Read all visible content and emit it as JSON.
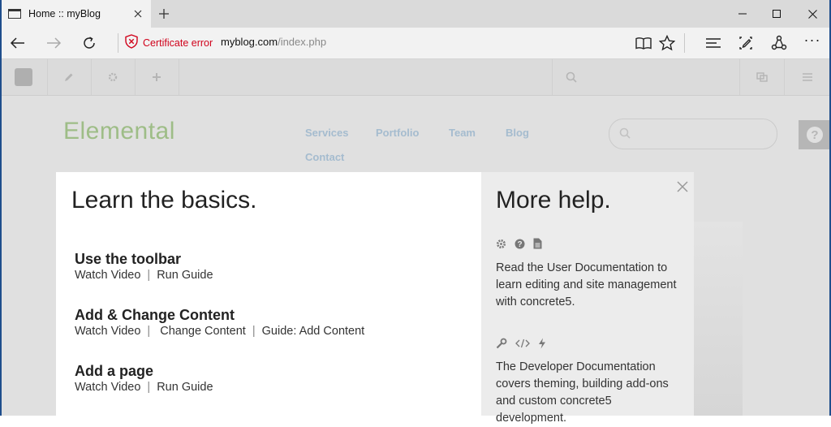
{
  "browser": {
    "tab": {
      "title": "Home :: myBlog"
    },
    "address": {
      "cert_label": "Certificate error",
      "url_host": "myblog.com",
      "url_path": "/index.php"
    }
  },
  "site": {
    "logo_text": "Elemental",
    "nav": [
      "Services",
      "Portfolio",
      "Team",
      "Blog",
      "Contact"
    ]
  },
  "modal": {
    "left_heading": "Learn the basics.",
    "guides": [
      {
        "title": "Use the toolbar",
        "links": [
          "Watch Video",
          "Run Guide"
        ]
      },
      {
        "title": "Add & Change Content",
        "links": [
          "Watch Video",
          "Change Content",
          "Guide: Add Content"
        ]
      },
      {
        "title": "Add a page",
        "links": [
          "Watch Video",
          "Run Guide"
        ]
      }
    ],
    "right_heading": "More help.",
    "user_doc_text": "Read the User Documentation to learn editing and site management with concrete5.",
    "dev_doc_text": "The Developer Documentation covers theming, building add-ons and custom concrete5 development."
  },
  "colors": {
    "cert_error": "#d0021b",
    "site_logo": "#b4d89a",
    "site_nav": "#bcd6ec",
    "modal_right_bg": "#ececec"
  },
  "icons": {
    "tab": "page-favicon-icon",
    "nav": [
      "back-arrow-icon",
      "forward-arrow-icon",
      "refresh-icon"
    ],
    "cert": "shield-x-icon",
    "toolbar": [
      "reading-view-icon",
      "favorite-star-icon",
      "hub-icon",
      "web-note-icon",
      "share-icon",
      "more-dots-icon"
    ],
    "help_user_doc": [
      "gear-icon",
      "question-icon",
      "document-icon"
    ],
    "help_dev_doc": [
      "wrench-icon",
      "code-icon",
      "lightning-icon"
    ]
  }
}
